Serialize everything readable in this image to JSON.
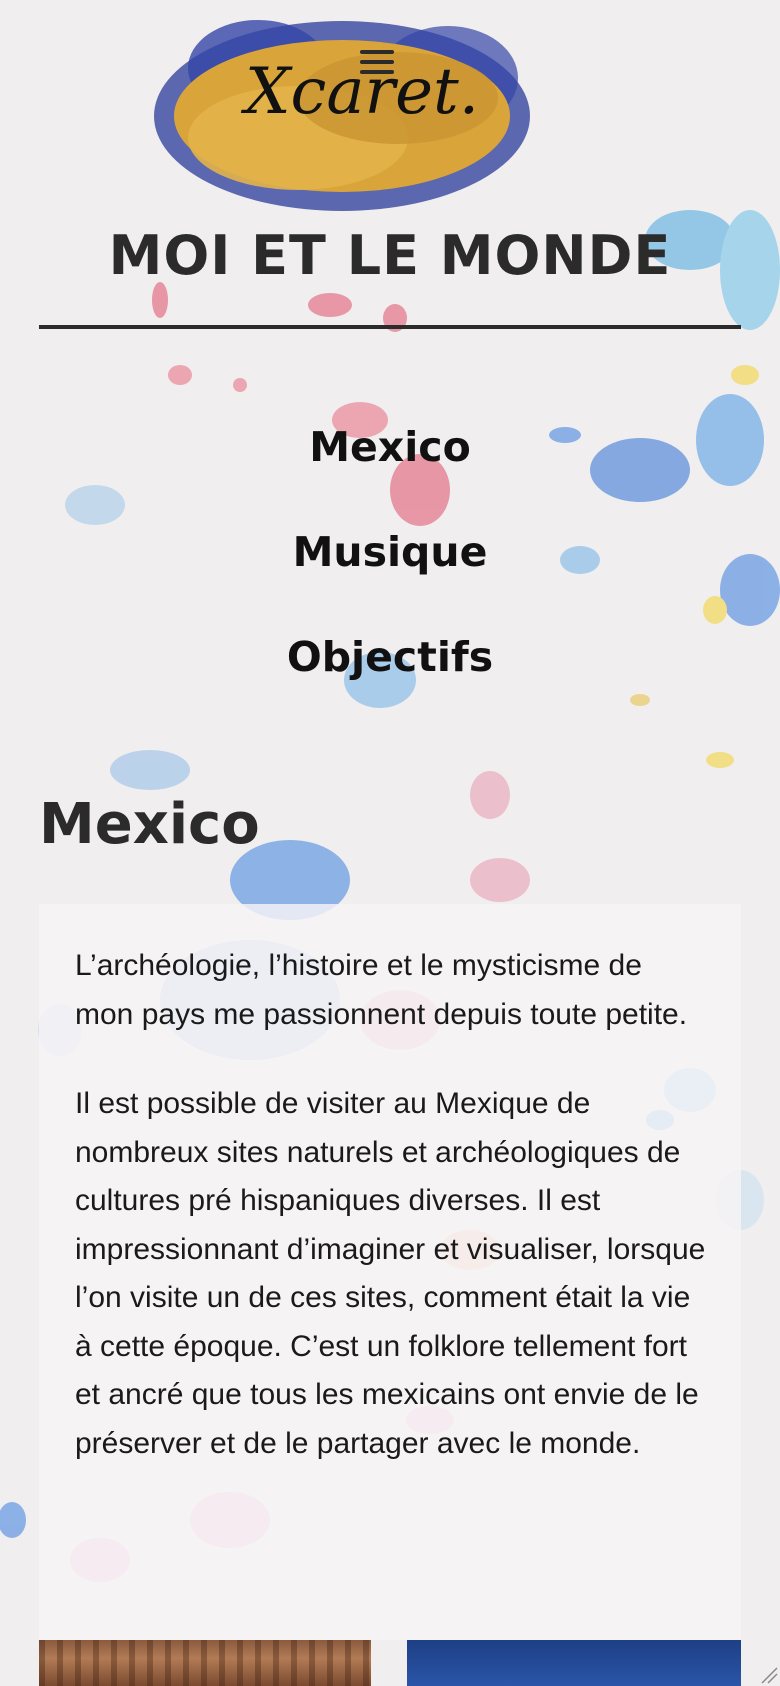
{
  "header": {
    "logo_text": "Xcaret.",
    "site_title": "MOI ET LE MONDE",
    "menu_icon": "hamburger-icon"
  },
  "nav": {
    "items": [
      {
        "label": "Mexico"
      },
      {
        "label": "Musique"
      },
      {
        "label": "Objectifs"
      }
    ]
  },
  "section": {
    "title": "Mexico",
    "paragraphs": [
      "L’archéologie, l’histoire et le mysticisme de mon pays me passionnent depuis toute petite.",
      "Il est possible de visiter au Mexique de nombreux sites naturels et archéologiques de cultures pré hispaniques diverses. Il est impressionnant d’imaginer et visualiser, lorsque l’on visite un de ces sites, comment était la vie à cette époque. C’est un folklore tellement fort et ancré que tous les mexicains ont envie de le préserver et de le partager avec le monde."
    ]
  },
  "colors": {
    "background": "#f0eeee",
    "text_dark": "#2b2b2b",
    "logo_gold": "#d9a53a",
    "logo_blue": "#2a3a9a"
  }
}
